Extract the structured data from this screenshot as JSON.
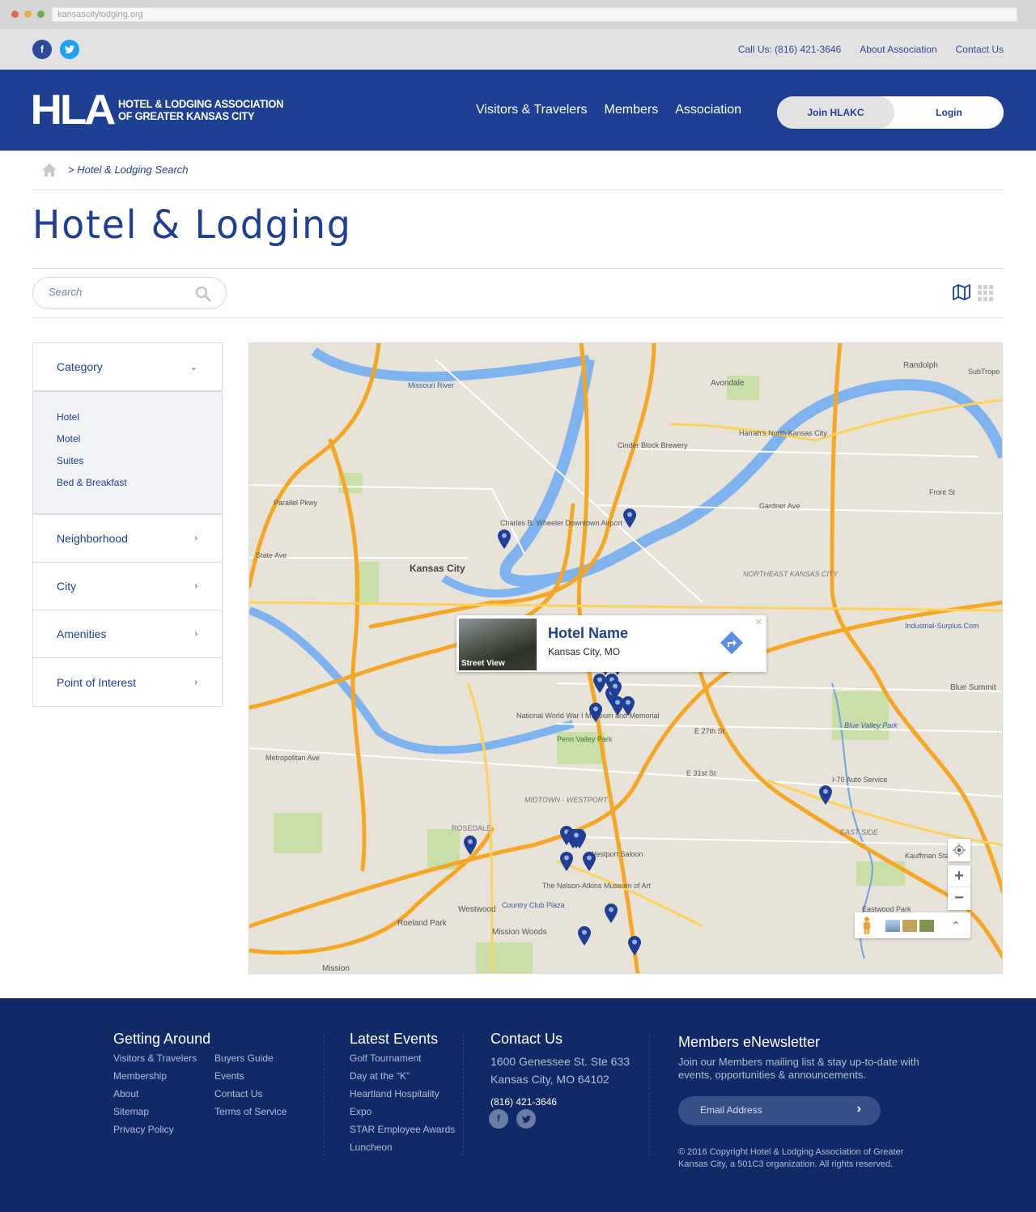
{
  "browser": {
    "url": "kansascitylodging.org"
  },
  "utility": {
    "social": {
      "facebook": "f",
      "twitter": "t"
    },
    "links": [
      "Call Us: (816) 421-3646",
      "About Association",
      "Contact Us"
    ]
  },
  "header": {
    "logo_mark": "HLA",
    "logo_line1": "HOTEL & LODGING ASSOCIATION",
    "logo_line2": "OF GREATER KANSAS CITY",
    "nav": [
      "Visitors & Travelers",
      "Members",
      "Association"
    ],
    "join_label": "Join HLAKC",
    "login_label": "Login"
  },
  "breadcrumb": {
    "current": "> Hotel & Lodging Search"
  },
  "page_title": "Hotel & Lodging",
  "search": {
    "placeholder": "Search",
    "value": ""
  },
  "view_toggle": {
    "active": "map",
    "options": [
      "map",
      "grid"
    ]
  },
  "filters": {
    "category": {
      "label": "Category",
      "expanded": true,
      "items": [
        "Hotel",
        "Motel",
        "Suites",
        "Bed & Breakfast"
      ]
    },
    "collapsed": [
      "Neighborhood",
      "City",
      "Amenities",
      "Point of Interest"
    ]
  },
  "map": {
    "labels": {
      "kansas_city": "Kansas City",
      "avondale": "Avondale",
      "randolph": "Randolph",
      "missouri_river": "Missouri River",
      "airport": "Charles B. Wheeler Downtown Airport",
      "wwi": "National World War I Museum and Memorial",
      "penn_valley": "Penn Valley Park",
      "midtown": "MIDTOWN - WESTPORT",
      "rosedale": "ROSEDALE",
      "westwood": "Westwood",
      "roeland_park": "Roeland Park",
      "mission": "Mission",
      "mission_woods": "Mission Woods",
      "country_club": "Country Club Plaza",
      "nelson_atkins": "The Nelson-Atkins Museum of Art",
      "blue_summit": "Blue Summit",
      "blue_valley": "Blue Valley Park",
      "northeast_kc": "NORTHEAST KANSAS CITY",
      "east_side": "EAST SIDE",
      "harrahs": "Harrah's North Kansas City",
      "cinder_block": "Cinder Block Brewery",
      "i70_auto": "I-70 Auto Service",
      "industrial_surplus": "Industrial-Surplus.Com",
      "subtropolis": "SubTropo",
      "front_st": "Front St",
      "gardner_ave": "Gardner Ave",
      "state_ave": "State Ave",
      "parallel_pkwy": "Parallel Pkwy",
      "metropolitan_ave": "Metropolitan Ave",
      "e_31st": "E 31st St",
      "e_27th": "E 27th St",
      "kauffman": "Kauffman Sta",
      "eastwood_park": "Eastwood Park",
      "westport_saloon": "Westport Saloon"
    },
    "pin_count": 22,
    "infowindow": {
      "thumb_label": "Street View",
      "name": "Hotel Name",
      "location": "Kansas City, MO",
      "close": "×"
    },
    "controls": {
      "zoom_in": "+",
      "zoom_out": "−",
      "expand": "⌃"
    }
  },
  "footer": {
    "getting_around": {
      "title": "Getting Around",
      "col1": [
        "Visitors & Travelers",
        "Membership",
        "About",
        "Sitemap",
        "Privacy Policy"
      ],
      "col2": [
        "Buyers Guide",
        "Events",
        "Contact Us",
        "Terms of Service"
      ]
    },
    "latest_events": {
      "title": "Latest Events",
      "items": [
        "Golf Tournament",
        "Day at the “K”",
        "Heartland Hospitality",
        "Expo",
        "STAR Employee Awards",
        "Luncheon"
      ]
    },
    "contact": {
      "title": "Contact Us",
      "address1": "1600 Genessee St. Ste 633",
      "address2": "Kansas City, MO 64102",
      "phone": "(816) 421-3646"
    },
    "newsletter": {
      "title": "Members eNewsletter",
      "description": "Join our Members mailing list & stay up-to-date with events, opportunities & announcements.",
      "email_placeholder": "Email Address",
      "copyright": "© 2016 Copyright Hotel & Lodging Association of Greater Kansas City, a 501C3 organization. All rights reserved."
    }
  },
  "colors": {
    "brand": "#1e3f94",
    "footer": "#112a67",
    "util_bar": "#e2e2e2",
    "highway": "#f5a623",
    "river": "#7eb3f0"
  }
}
